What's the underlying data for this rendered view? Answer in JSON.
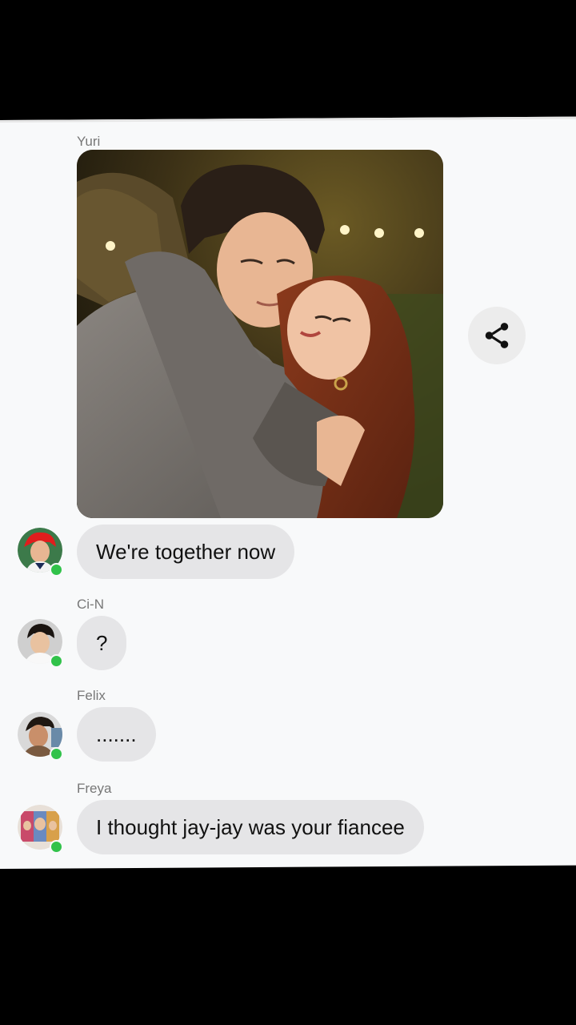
{
  "messages": [
    {
      "sender": "Yuri",
      "photo_alt": "",
      "text": "We're together now"
    },
    {
      "sender": "Ci-N",
      "text": "?"
    },
    {
      "sender": "Felix",
      "text": "......."
    },
    {
      "sender": "Freya",
      "text": "I thought jay-jay was your fiancee"
    }
  ],
  "icons": {
    "share": "share-icon"
  },
  "colors": {
    "bubble": "#e5e5e7",
    "online": "#31c24a",
    "background": "#f8f9fa"
  }
}
